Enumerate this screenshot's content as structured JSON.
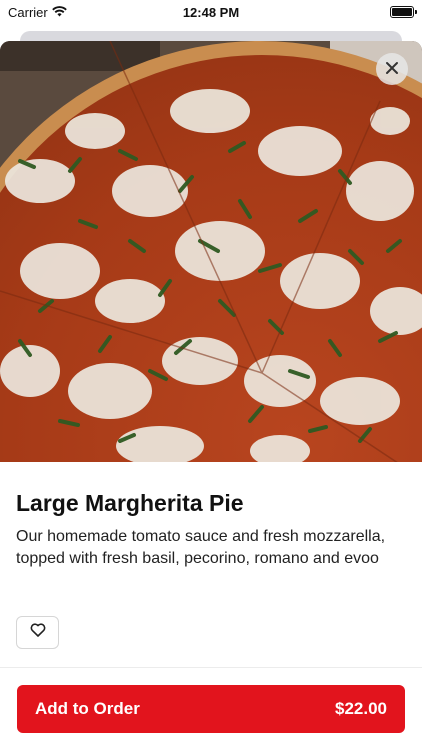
{
  "status_bar": {
    "carrier": "Carrier",
    "time": "12:48 PM",
    "wifi_icon": "wifi-icon",
    "battery_icon": "battery-icon"
  },
  "item": {
    "image": "margherita-pizza-photo",
    "title": "Large Margherita Pie",
    "description": "Our homemade tomato sauce and fresh mozzarella, topped with fresh basil, pecorino, romano and evoo"
  },
  "actions": {
    "close_icon": "close-icon",
    "favorite_icon": "heart-icon",
    "add_label": "Add to Order",
    "price": "$22.00"
  },
  "colors": {
    "accent": "#e2141d"
  }
}
